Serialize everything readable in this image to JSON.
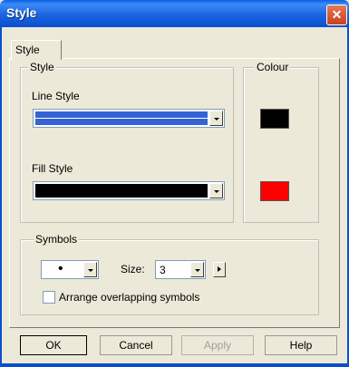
{
  "window": {
    "title": "Style",
    "close_icon": "close-icon"
  },
  "tabs": [
    {
      "label": "Style"
    }
  ],
  "style_group": {
    "label": "Style",
    "line_style_label": "Line Style",
    "line_style_color": "#3563d6",
    "fill_style_label": "Fill Style",
    "fill_style_color": "#000000"
  },
  "colour_group": {
    "label": "Colour",
    "line_colour": "#000000",
    "fill_colour": "#ff0000"
  },
  "symbols_group": {
    "label": "Symbols",
    "symbol_value": "•",
    "size_label": "Size:",
    "size_value": "3",
    "arrange_label": "Arrange overlapping symbols",
    "arrange_checked": false
  },
  "buttons": {
    "ok": "OK",
    "cancel": "Cancel",
    "apply": "Apply",
    "help": "Help"
  }
}
